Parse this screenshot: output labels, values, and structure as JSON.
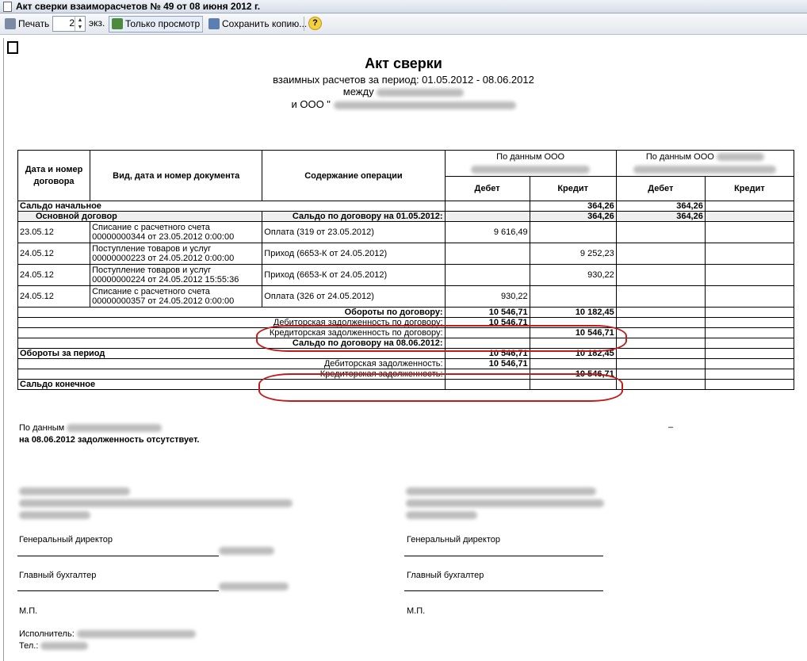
{
  "window": {
    "title": "Акт сверки взаиморасчетов № 49 от 08 июня 2012 г."
  },
  "toolbar": {
    "print_label": "Печать",
    "copies_value": "2",
    "copies_unit": "экз.",
    "view_only_label": "Только просмотр",
    "save_copy_label": "Сохранить копию...",
    "help_glyph": "?"
  },
  "doc": {
    "title": "Акт сверки",
    "subtitle": "взаимных расчетов за период: 01.05.2012 - 08.06.2012",
    "between": "между",
    "and_prefix": "и ООО \""
  },
  "table": {
    "headers": {
      "date": "Дата и номер договора",
      "doc": "Вид, дата и номер документа",
      "content": "Содержание операции",
      "ours": "По данным ООО",
      "theirs": "По данным ООО",
      "debit": "Дебет",
      "credit": "Кредит"
    },
    "saldo_start": {
      "label": "Сальдо начальное",
      "credit": "364,26",
      "debit2": "364,26"
    },
    "contract": {
      "label": "Основной договор",
      "saldo_label": "Сальдо по договору на 01.05.2012:",
      "credit": "364,26",
      "debit2": "364,26"
    },
    "rows": [
      {
        "date": "23.05.12",
        "doc1": "Списание с расчетного счета",
        "doc2": "00000000344 от 23.05.2012 0:00:00",
        "content": "Оплата (319 от 23.05.2012)",
        "debit": "9 616,49",
        "credit": ""
      },
      {
        "date": "24.05.12",
        "doc1": "Поступление товаров и услуг",
        "doc2": "00000000223 от 24.05.2012 0:00:00",
        "content": "Приход (6653-К от 24.05.2012)",
        "debit": "",
        "credit": "9 252,23"
      },
      {
        "date": "24.05.12",
        "doc1": "Поступление товаров и услуг",
        "doc2": "00000000224 от 24.05.2012 15:55:36",
        "content": "Приход (6653-К от 24.05.2012)",
        "debit": "",
        "credit": "930,22"
      },
      {
        "date": "24.05.12",
        "doc1": "Списание с расчетного счета",
        "doc2": "00000000357 от 24.05.2012 0:00:00",
        "content": "Оплата (326 от 24.05.2012)",
        "debit": "930,22",
        "credit": ""
      }
    ],
    "turnover_contract": {
      "label": "Обороты по договору:",
      "debit": "10 546,71",
      "credit": "10 182,45"
    },
    "debt_debit_contract": {
      "label": "Дебиторская задолженность по договору:",
      "debit": "10 546,71"
    },
    "debt_credit_contract": {
      "label": "Кредиторская задолженность по договору:",
      "credit": "10 546,71"
    },
    "saldo_contract_end": {
      "label": "Сальдо по договору на 08.06.2012:"
    },
    "turnover_period": {
      "label": "Обороты за период",
      "debit": "10 546,71",
      "credit": "10 182,45"
    },
    "debt_debit": {
      "label": "Дебиторская задолженность:",
      "debit": "10 546,71"
    },
    "debt_credit": {
      "label": "Кредиторская задолженность:",
      "credit": "10 546,71"
    },
    "saldo_end": {
      "label": "Сальдо конечное"
    }
  },
  "footer": {
    "by_data": "По данным",
    "dash": "–",
    "conclusion": "на 08.06.2012 задолженность отсутствует.",
    "gen_dir": "Генеральный директор",
    "chief_acc": "Главный бухгалтер",
    "stamp": "М.П.",
    "executor": "Исполнитель:",
    "phone": "Тел.:"
  },
  "colors": {
    "highlight": "#c31a1a"
  }
}
